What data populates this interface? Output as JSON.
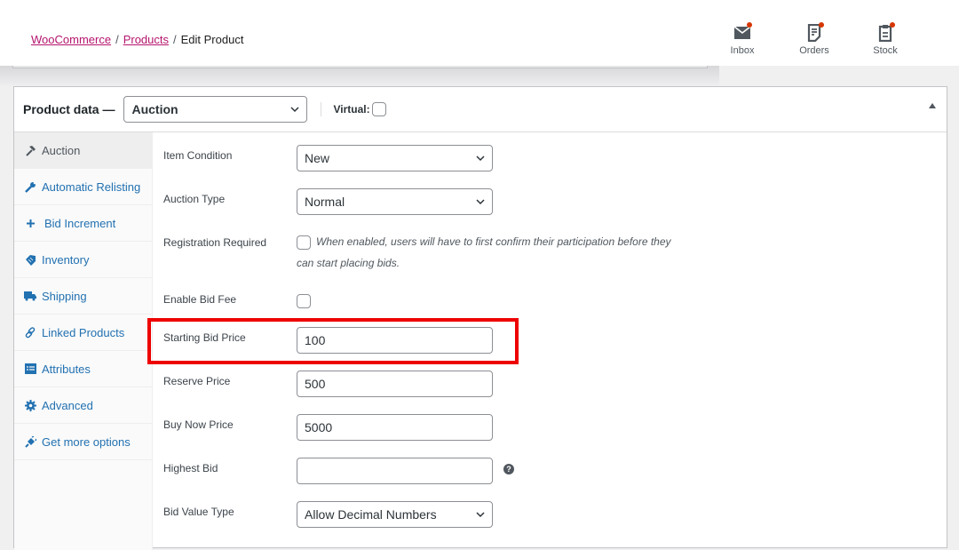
{
  "breadcrumb": {
    "items": [
      {
        "label": "WooCommerce",
        "link": true
      },
      {
        "label": "Products",
        "link": true
      },
      {
        "label": "Edit Product",
        "link": false
      }
    ],
    "separator": "/"
  },
  "activity_bar": [
    {
      "label": "Inbox",
      "icon": "envelope-icon",
      "has_notification": true
    },
    {
      "label": "Orders",
      "icon": "orders-icon",
      "has_notification": true
    },
    {
      "label": "Stock",
      "icon": "clipboard-icon",
      "has_notification": true
    }
  ],
  "panel": {
    "title": "Product data —",
    "product_type": "Auction",
    "virtual_label": "Virtual:",
    "virtual_checked": false
  },
  "tabs": [
    {
      "label": "Auction",
      "icon": "hammer-icon",
      "active": true
    },
    {
      "label": "Automatic Relisting",
      "icon": "wrench-icon",
      "active": false
    },
    {
      "label": "Bid Increment",
      "icon": "plus-icon",
      "active": false
    },
    {
      "label": "Inventory",
      "icon": "tag-icon",
      "active": false
    },
    {
      "label": "Shipping",
      "icon": "truck-icon",
      "active": false
    },
    {
      "label": "Linked Products",
      "icon": "link-icon",
      "active": false
    },
    {
      "label": "Attributes",
      "icon": "list-icon",
      "active": false
    },
    {
      "label": "Advanced",
      "icon": "gear-icon",
      "active": false
    },
    {
      "label": "Get more options",
      "icon": "plugin-icon",
      "active": false
    }
  ],
  "fields": {
    "item_condition": {
      "label": "Item Condition",
      "value": "New"
    },
    "auction_type": {
      "label": "Auction Type",
      "value": "Normal"
    },
    "registration_required": {
      "label": "Registration Required",
      "checked": false,
      "description": "When enabled, users will have to first confirm their participation before they can start placing bids."
    },
    "enable_bid_fee": {
      "label": "Enable Bid Fee",
      "checked": false
    },
    "starting_bid_price": {
      "label": "Starting Bid Price",
      "value": "100"
    },
    "reserve_price": {
      "label": "Reserve Price",
      "value": "500"
    },
    "buy_now_price": {
      "label": "Buy Now Price",
      "value": "5000"
    },
    "highest_bid": {
      "label": "Highest Bid",
      "value": "",
      "help": "?"
    },
    "bid_value_type": {
      "label": "Bid Value Type",
      "value": "Allow Decimal Numbers"
    }
  },
  "colors": {
    "link": "#b5156e",
    "tab_link": "#2271b1",
    "notification": "#d63600",
    "highlight": "#ee0000"
  }
}
